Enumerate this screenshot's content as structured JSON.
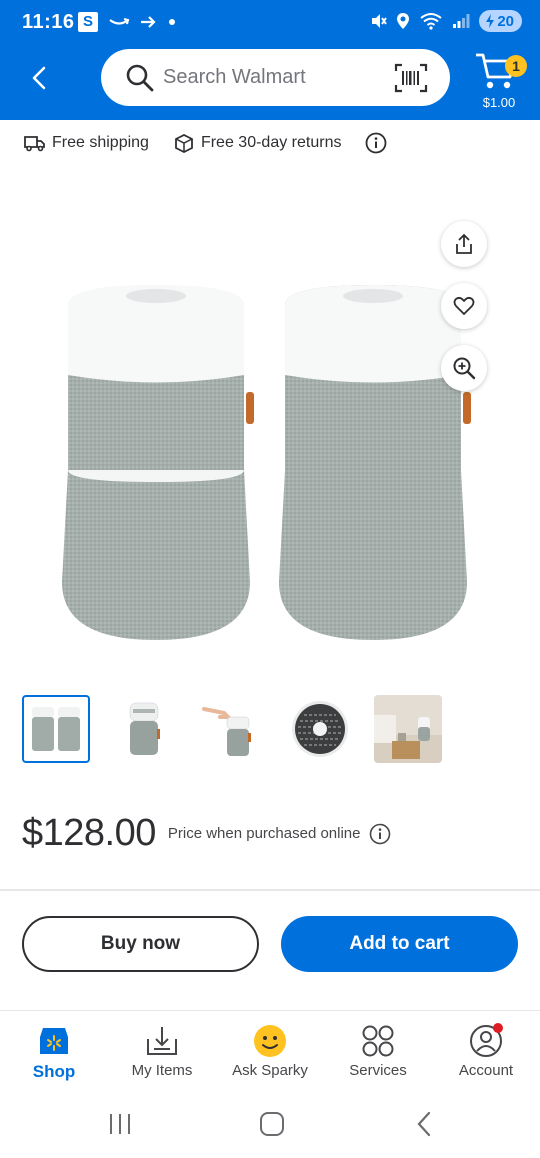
{
  "status_bar": {
    "time": "11:16",
    "s_badge": "S",
    "battery": "20",
    "wifi_label": "5"
  },
  "header": {
    "search_placeholder": "Search Walmart",
    "cart_count": "1",
    "cart_total": "$1.00",
    "brand_color": "#0071dc",
    "badge_color": "#ffc220"
  },
  "shipping": {
    "free_shipping": "Free shipping",
    "free_returns": "Free 30-day returns"
  },
  "product": {
    "price": "$128.00",
    "price_note": "Price when purchased online",
    "thumbnails": [
      "two-purifiers",
      "single-purifier",
      "hand-on-purifier",
      "filter-top-view",
      "purifier-on-nightstand"
    ]
  },
  "actions": {
    "buy_now": "Buy now",
    "add_to_cart": "Add to cart"
  },
  "tabs": [
    {
      "label": "Shop",
      "icon": "shop-icon",
      "active": true
    },
    {
      "label": "My Items",
      "icon": "my-items-icon",
      "active": false
    },
    {
      "label": "Ask Sparky",
      "icon": "sparky-icon",
      "active": false
    },
    {
      "label": "Services",
      "icon": "services-icon",
      "active": false
    },
    {
      "label": "Account",
      "icon": "account-icon",
      "active": false
    }
  ]
}
